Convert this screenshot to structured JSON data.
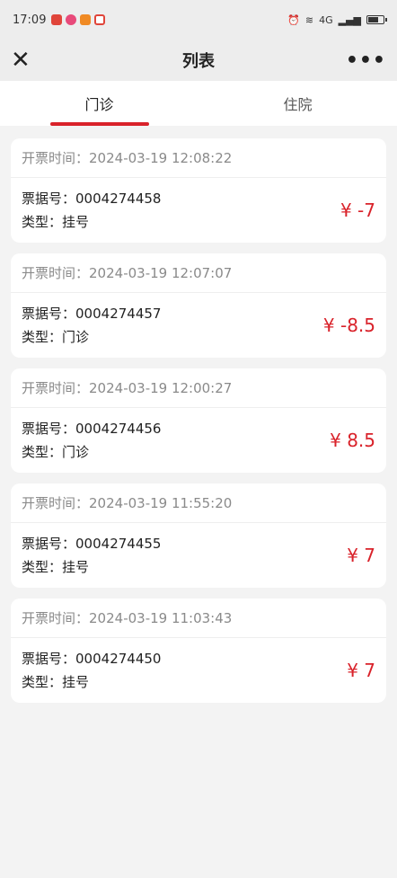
{
  "status_bar": {
    "time": "17:09",
    "network": "4G"
  },
  "nav": {
    "title": "列表",
    "more": "•••"
  },
  "tabs": [
    {
      "label": "门诊",
      "active": true
    },
    {
      "label": "住院",
      "active": false
    }
  ],
  "list": [
    {
      "time_label": "开票时间：",
      "time": "2024-03-19 12:08:22",
      "bill_label": "票据号：",
      "bill_no": "0004274458",
      "type_label": "类型：",
      "type": "挂号",
      "amount": "¥ -7"
    },
    {
      "time_label": "开票时间：",
      "time": "2024-03-19 12:07:07",
      "bill_label": "票据号：",
      "bill_no": "0004274457",
      "type_label": "类型：",
      "type": "门诊",
      "amount": "¥ -8.5"
    },
    {
      "time_label": "开票时间：",
      "time": "2024-03-19 12:00:27",
      "bill_label": "票据号：",
      "bill_no": "0004274456",
      "type_label": "类型：",
      "type": "门诊",
      "amount": "¥ 8.5"
    },
    {
      "time_label": "开票时间：",
      "time": "2024-03-19 11:55:20",
      "bill_label": "票据号：",
      "bill_no": "0004274455",
      "type_label": "类型：",
      "type": "挂号",
      "amount": "¥ 7"
    },
    {
      "time_label": "开票时间：",
      "time": "2024-03-19 11:03:43",
      "bill_label": "票据号：",
      "bill_no": "0004274450",
      "type_label": "类型：",
      "type": "挂号",
      "amount": "¥ 7"
    }
  ],
  "colors": {
    "accent": "#d9222a",
    "background": "#f3f3f3",
    "muted_text": "#8a8a8a"
  }
}
